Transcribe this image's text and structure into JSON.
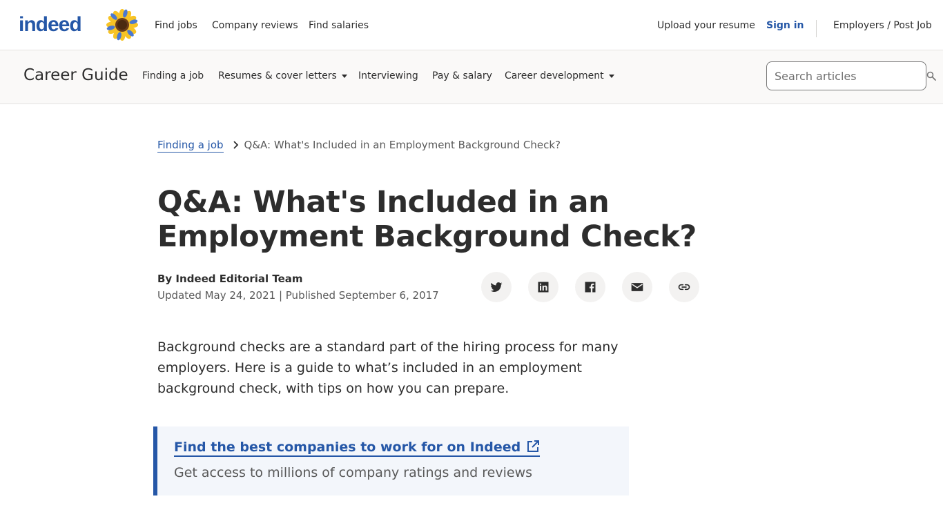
{
  "header": {
    "logo": "indeed",
    "nav": {
      "find_jobs": "Find jobs",
      "company_reviews": "Company reviews",
      "find_salaries": "Find salaries",
      "upload_resume": "Upload your resume",
      "sign_in": "Sign in",
      "employers": "Employers / Post Job"
    }
  },
  "guide": {
    "title": "Career Guide",
    "items": [
      {
        "label": "Finding a job"
      },
      {
        "label": "Resumes & cover letters"
      },
      {
        "label": "Interviewing"
      },
      {
        "label": "Pay & salary"
      },
      {
        "label": "Career development"
      }
    ],
    "search_placeholder": "Search articles"
  },
  "breadcrumb": {
    "parent": "Finding a job",
    "current": "Q&A: What's Included in an Employment Background Check?"
  },
  "article": {
    "title": "Q&A: What's Included in an Employment Background Check?",
    "author": "By Indeed Editorial Team",
    "dates": "Updated May 24, 2021 | Published September 6, 2017",
    "intro": "Background checks are a standard part of the hiring process for many employers. Here is a guide to what’s included in an employment background check, with tips on how you can prepare."
  },
  "share_icons": [
    "twitter-icon",
    "linkedin-icon",
    "facebook-icon",
    "email-icon",
    "link-icon"
  ],
  "callout": {
    "link_text": "Find the best companies to work for on Indeed",
    "subtext": "Get access to millions of company ratings and reviews"
  },
  "colors": {
    "brand_blue": "#2557a7",
    "text": "#2d2d2d",
    "muted": "#595959",
    "guide_bg": "#faf9f8",
    "callout_bg": "#f3f6fb"
  }
}
